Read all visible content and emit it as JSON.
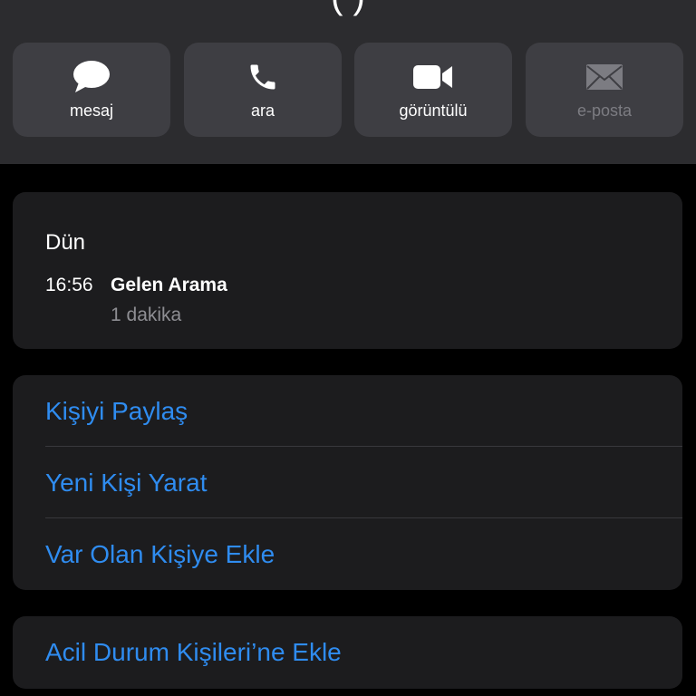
{
  "header": {
    "title_partial": "( )"
  },
  "actions": [
    {
      "label": "mesaj",
      "icon": "message-bubble-icon",
      "enabled": true
    },
    {
      "label": "ara",
      "icon": "phone-icon",
      "enabled": true
    },
    {
      "label": "görüntülü",
      "icon": "video-camera-icon",
      "enabled": true
    },
    {
      "label": "e-posta",
      "icon": "envelope-icon",
      "enabled": false
    }
  ],
  "recents": {
    "day": "Dün",
    "time": "16:56",
    "type": "Gelen Arama",
    "duration": "1 dakika"
  },
  "contact_actions": {
    "share": "Kişiyi Paylaş",
    "create": "Yeni Kişi Yarat",
    "add_existing": "Var Olan Kişiye Ekle"
  },
  "emergency": {
    "add": "Acil Durum Kişileri’ne Ekle"
  },
  "colors": {
    "accent": "#2f8cf0",
    "background": "#000000",
    "header": "#2c2c2f",
    "card": "#1c1c1e",
    "action_button": "#3e3e43",
    "secondary_text": "#8e8e93",
    "disabled_text": "#7c7c82"
  }
}
